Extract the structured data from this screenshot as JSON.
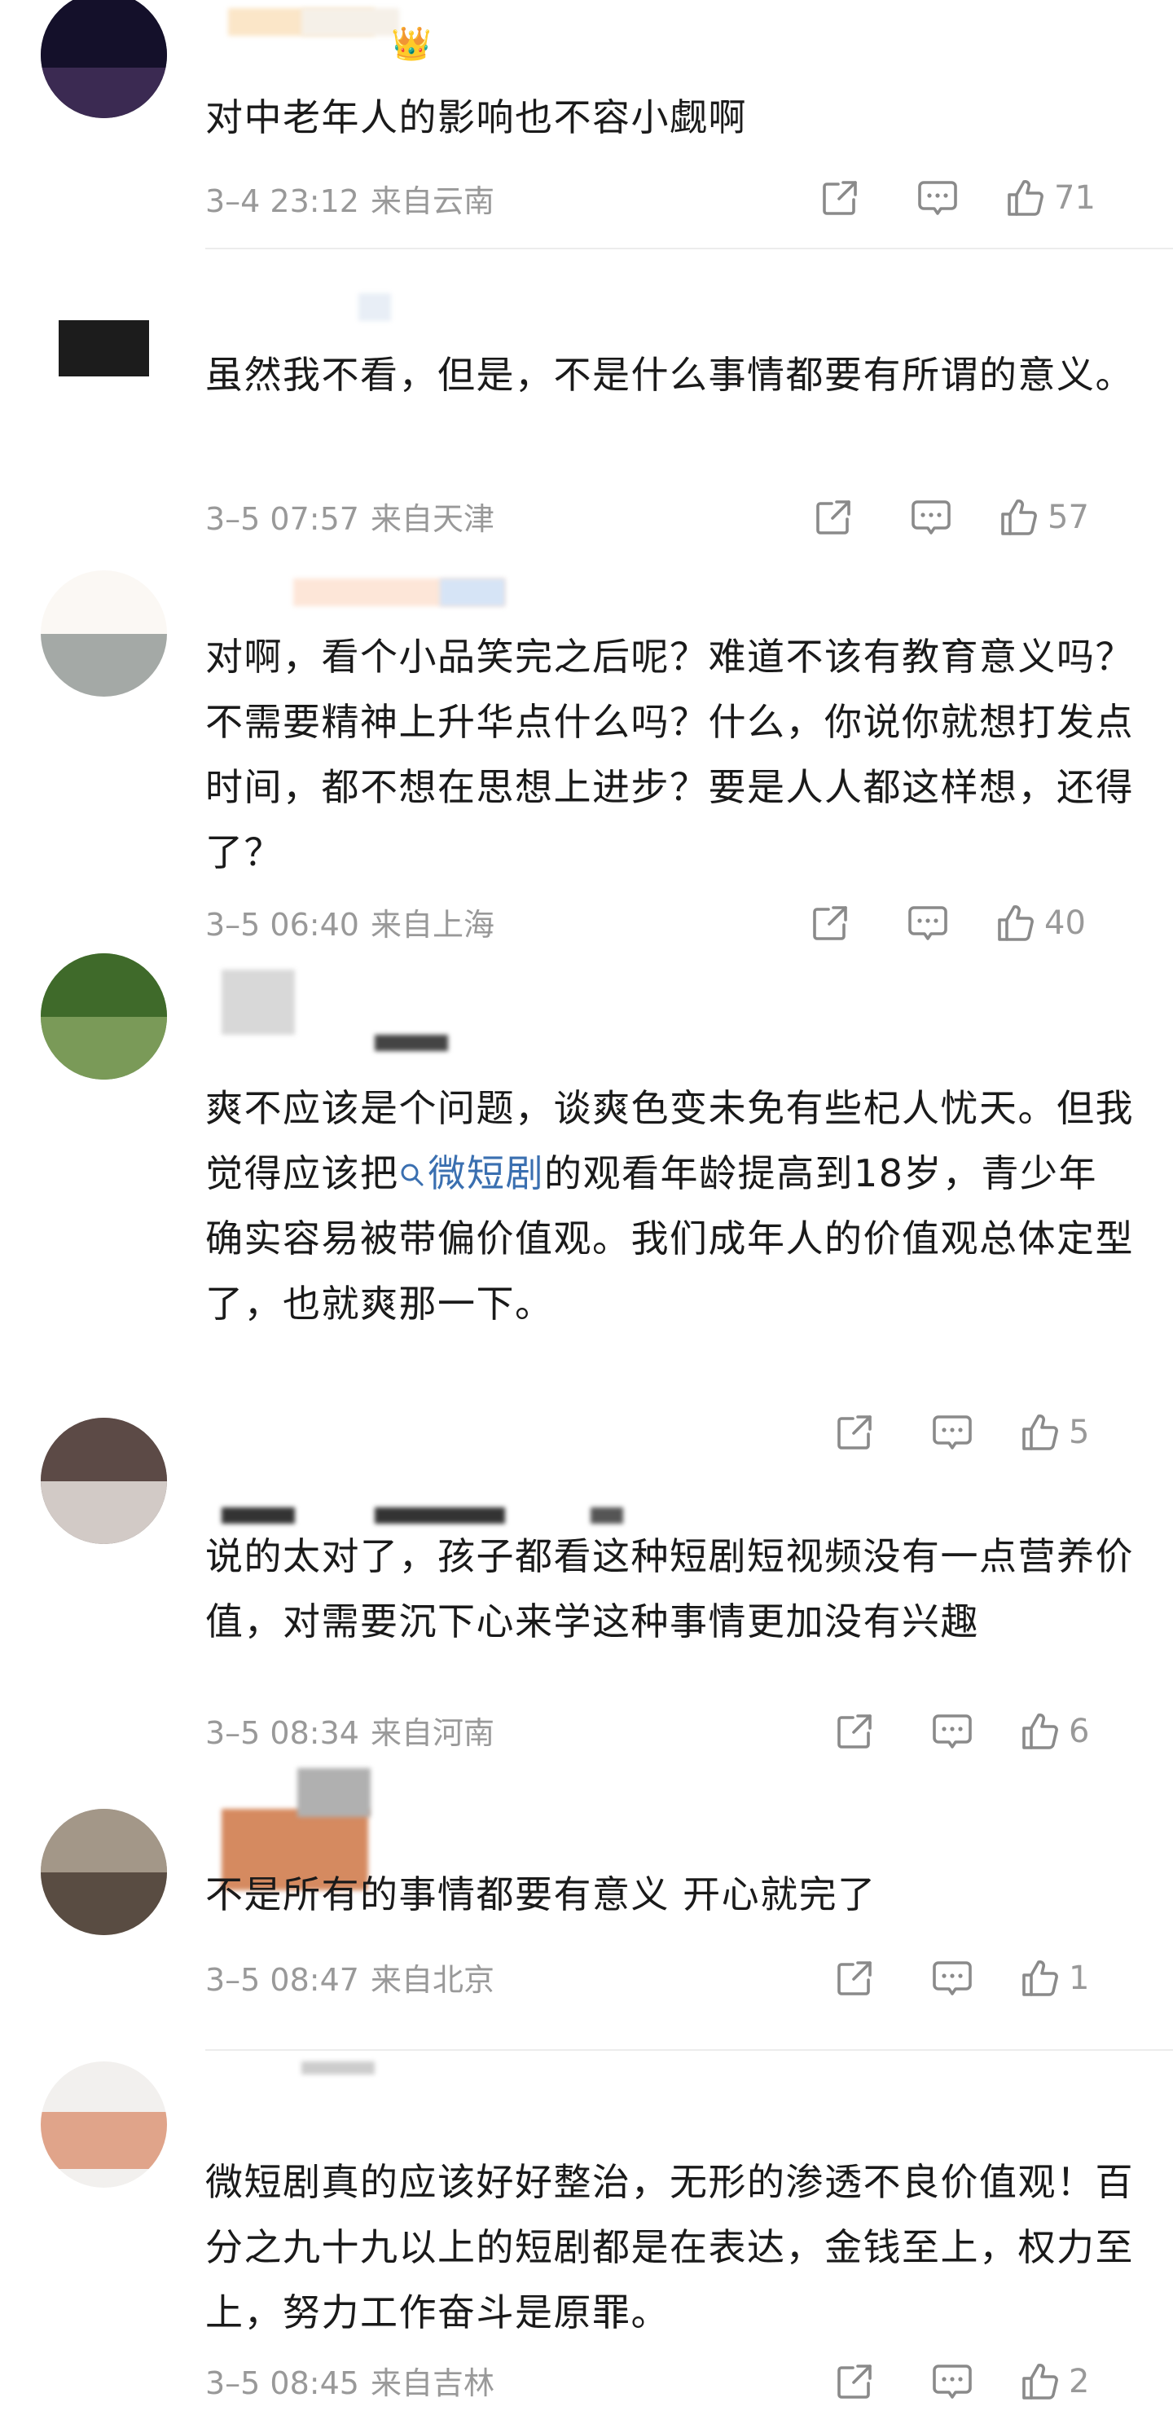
{
  "comments": [
    {
      "text": "对中老年人的影响也不容小觑啊",
      "date": "3–4 23:12",
      "location": "来自云南",
      "likes": "71"
    },
    {
      "text": "虽然我不看，但是，不是什么事情都要有所谓的意义。",
      "date": "3–5 07:57",
      "location": "来自天津",
      "likes": "57"
    },
    {
      "text": "对啊，看个小品笑完之后呢？难道不该有教育意义吗？不需要精神上升华点什么吗？什么，你说你就想打发点时间，都不想在思想上进步？要是人人都这样想，还得了？",
      "date": "3–5 06:40",
      "location": "来自上海",
      "likes": "40"
    },
    {
      "text_before": "爽不应该是个问题，谈爽色变未免有些杞人忧天。但我觉得应该把",
      "keyword": "微短剧",
      "text_after": "的观看年龄提高到18岁，青少年确实容易被带偏价值观。我们成年人的价值观总体定型了，也就爽那一下。",
      "likes": "5"
    },
    {
      "text": "说的太对了，孩子都看这种短剧短视频没有一点营养价值，对需要沉下心来学这种事情更加没有兴趣",
      "date": "3–5 08:34",
      "location": "来自河南",
      "likes": "6"
    },
    {
      "text": "不是所有的事情都要有意义 开心就完了",
      "date": "3–5 08:47",
      "location": "来自北京",
      "likes": "1"
    },
    {
      "text": "微短剧真的应该好好整治，无形的渗透不良价值观！百分之九十九以上的短剧都是在表达，金钱至上，权力至上，努力工作奋斗是原罪。",
      "date": "3–5 08:45",
      "location": "来自吉林",
      "likes": "2"
    }
  ],
  "colors": {
    "text": "#1a1a1a",
    "meta": "#999999",
    "link": "#3a6fb0",
    "divider": "#ececec"
  },
  "icons": [
    "share-icon",
    "comment-icon",
    "thumbs-up-icon",
    "search-icon",
    "crown-emoji-icon"
  ]
}
